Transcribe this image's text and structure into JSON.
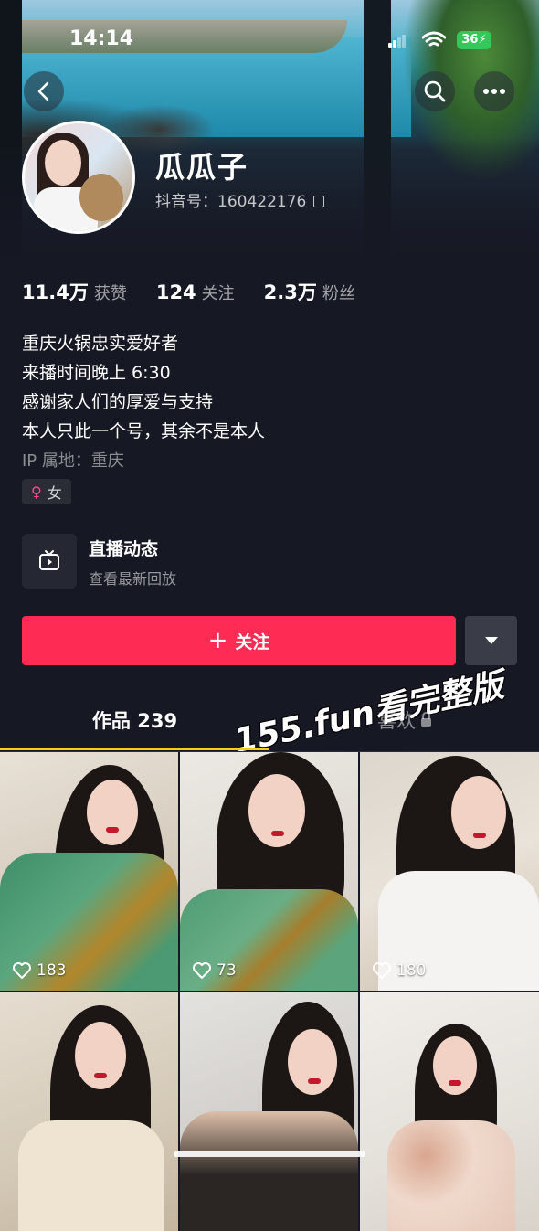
{
  "status_bar": {
    "time": "14:14",
    "battery": "36"
  },
  "profile": {
    "name": "瓜瓜子",
    "douyin_id": "抖音号：160422176",
    "stats": [
      {
        "value": "11.4万",
        "label": "获赞"
      },
      {
        "value": "124",
        "label": "关注"
      },
      {
        "value": "2.3万",
        "label": "粉丝"
      }
    ],
    "bio": [
      "重庆火锅忠实爱好者",
      "来播时间晚上 6:30",
      "感谢家人们的厚爱与支持",
      "本人只此一个号，其余不是本人"
    ],
    "ip_location": "IP 属地：重庆",
    "gender_label": "女"
  },
  "live": {
    "title": "直播动态",
    "subtitle": "查看最新回放"
  },
  "watermark": "155.fun看完整版",
  "actions": {
    "follow_label": "关注"
  },
  "tabs": [
    {
      "label": "作品 239"
    },
    {
      "label": "喜欢"
    }
  ],
  "videos": [
    {
      "likes": "183"
    },
    {
      "likes": "73"
    },
    {
      "likes": "180"
    },
    {
      "likes": ""
    },
    {
      "likes": ""
    },
    {
      "likes": ""
    }
  ],
  "colors": {
    "follow": "#fe2c55",
    "tab_indicator": "#face15",
    "background": "#161823"
  }
}
